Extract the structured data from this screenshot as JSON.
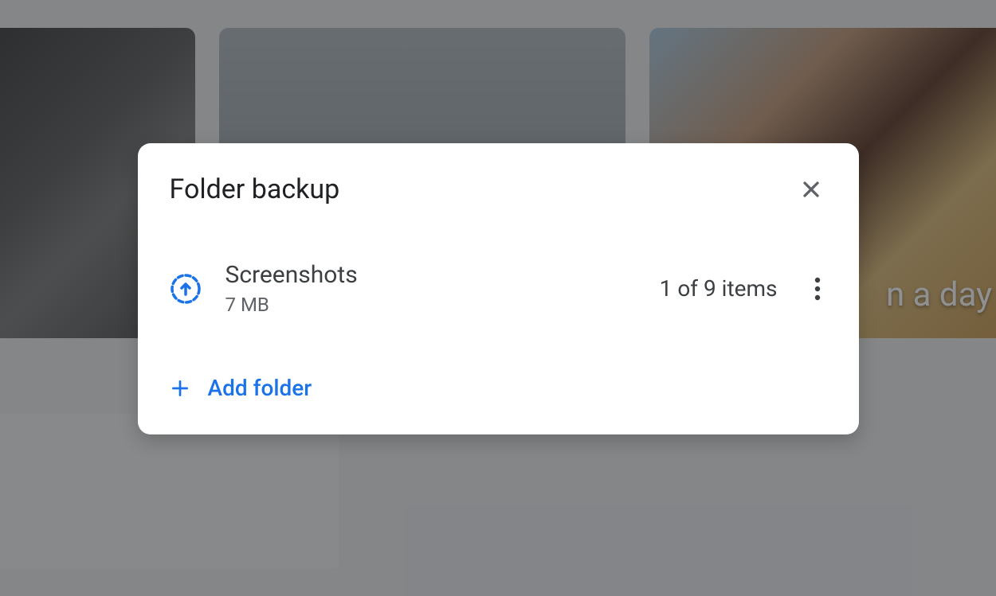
{
  "dialog": {
    "title": "Folder backup",
    "folders": [
      {
        "name": "Screenshots",
        "size": "7 MB",
        "status": "1 of 9 items"
      }
    ],
    "addFolderLabel": "Add folder"
  },
  "background": {
    "photo3Text": "n a day"
  }
}
